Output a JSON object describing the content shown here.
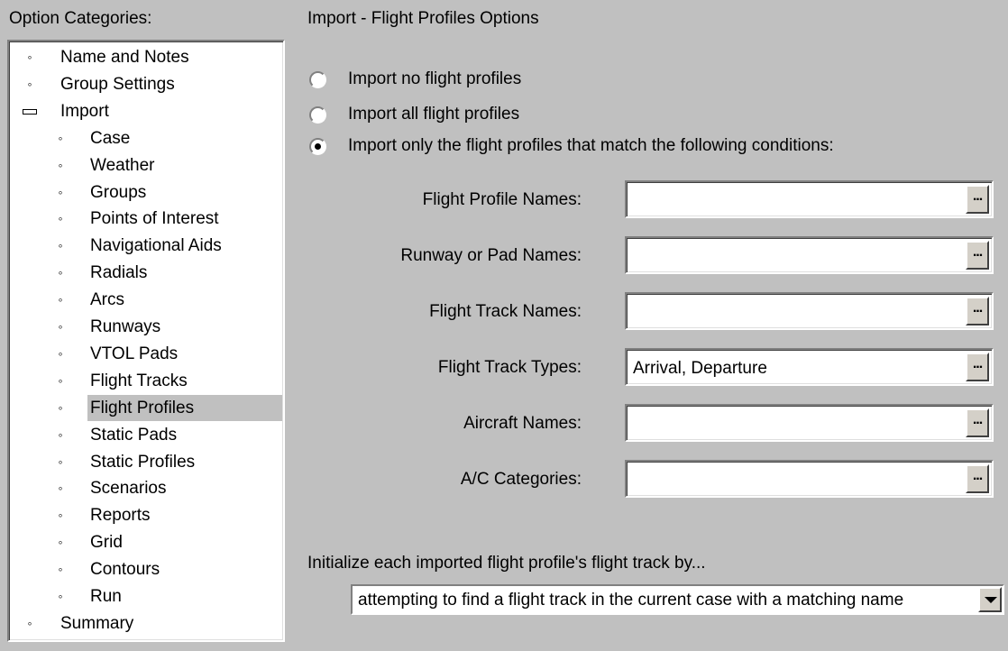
{
  "left_panel": {
    "title": "Option Categories:",
    "items": [
      {
        "label": "Name and Notes",
        "level": 0,
        "marker": "bullet"
      },
      {
        "label": "Group Settings",
        "level": 0,
        "marker": "bullet"
      },
      {
        "label": "Import",
        "level": 0,
        "marker": "minus"
      },
      {
        "label": "Case",
        "level": 1,
        "marker": "bullet"
      },
      {
        "label": "Weather",
        "level": 1,
        "marker": "bullet"
      },
      {
        "label": "Groups",
        "level": 1,
        "marker": "bullet"
      },
      {
        "label": "Points of Interest",
        "level": 1,
        "marker": "bullet"
      },
      {
        "label": "Navigational Aids",
        "level": 1,
        "marker": "bullet"
      },
      {
        "label": "Radials",
        "level": 1,
        "marker": "bullet"
      },
      {
        "label": "Arcs",
        "level": 1,
        "marker": "bullet"
      },
      {
        "label": "Runways",
        "level": 1,
        "marker": "bullet"
      },
      {
        "label": "VTOL Pads",
        "level": 1,
        "marker": "bullet"
      },
      {
        "label": "Flight Tracks",
        "level": 1,
        "marker": "bullet"
      },
      {
        "label": "Flight Profiles",
        "level": 1,
        "marker": "bullet",
        "selected": true
      },
      {
        "label": "Static Pads",
        "level": 1,
        "marker": "bullet"
      },
      {
        "label": "Static Profiles",
        "level": 1,
        "marker": "bullet"
      },
      {
        "label": "Scenarios",
        "level": 1,
        "marker": "bullet"
      },
      {
        "label": "Reports",
        "level": 1,
        "marker": "bullet"
      },
      {
        "label": "Grid",
        "level": 1,
        "marker": "bullet"
      },
      {
        "label": "Contours",
        "level": 1,
        "marker": "bullet"
      },
      {
        "label": "Run",
        "level": 1,
        "marker": "bullet"
      },
      {
        "label": "Summary",
        "level": 0,
        "marker": "bullet"
      }
    ]
  },
  "right_panel": {
    "title": "Import - Flight Profiles Options",
    "radios": [
      {
        "label": "Import no flight profiles",
        "checked": false
      },
      {
        "label": "Import all flight profiles",
        "checked": false
      },
      {
        "label": "Import only the flight profiles that match the following conditions:",
        "checked": true
      }
    ],
    "fields": [
      {
        "label": "Flight Profile Names:",
        "value": "",
        "button": "..."
      },
      {
        "label": "Runway or Pad Names:",
        "value": "",
        "button": "..."
      },
      {
        "label": "Flight Track Names:",
        "value": "",
        "button": "..."
      },
      {
        "label": "Flight Track Types:",
        "value": "Arrival, Departure",
        "button": "..."
      },
      {
        "label": "Aircraft Names:",
        "value": "",
        "button": "..."
      },
      {
        "label": "A/C Categories:",
        "value": "",
        "button": "..."
      }
    ],
    "init_label": "Initialize each imported flight profile's flight track by...",
    "init_dropdown": {
      "selected": "attempting to find a flight track in the current case with a matching name"
    }
  },
  "colors": {
    "background": "#c0c0c0",
    "selected_item": "#c0c0c0",
    "field_bg": "#ffffff"
  }
}
